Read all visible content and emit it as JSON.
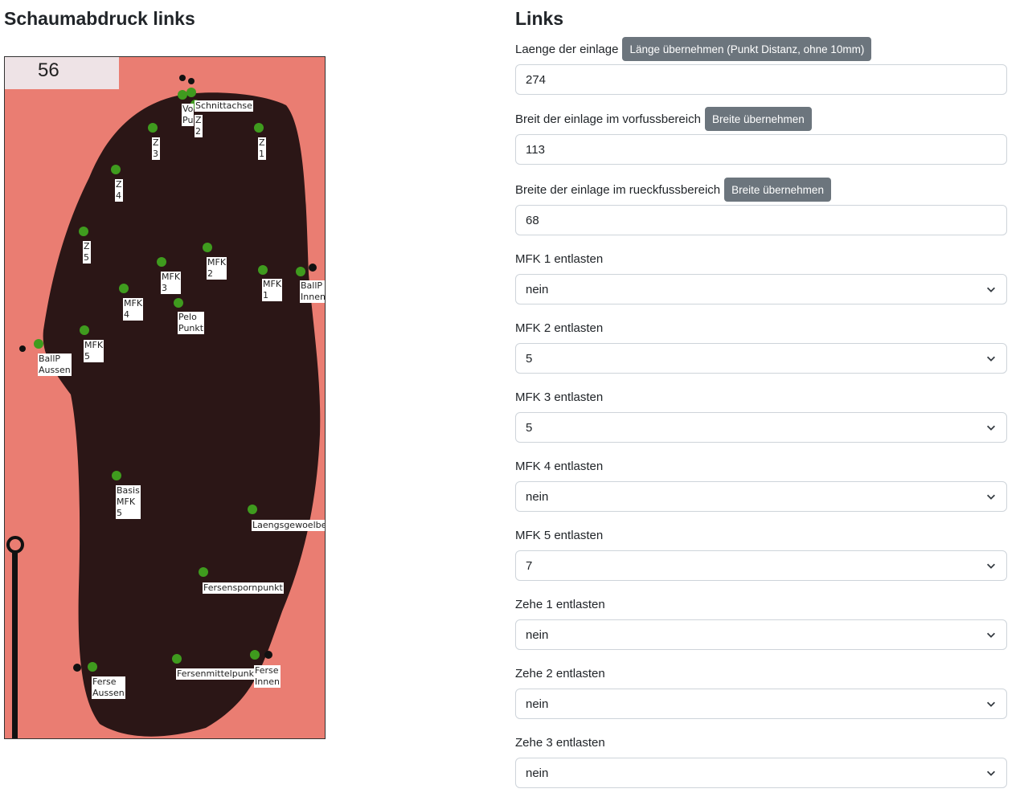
{
  "left": {
    "title": "Schaumabdruck links",
    "scan_number": "56",
    "points": [
      {
        "key": "schnittachse",
        "label": "Schnittachse"
      },
      {
        "key": "vo_punkt",
        "label": "Vo\nPu"
      },
      {
        "key": "z2",
        "label": "Z\n2"
      },
      {
        "key": "z3",
        "label": "Z\n3"
      },
      {
        "key": "z1",
        "label": "Z\n1"
      },
      {
        "key": "z4",
        "label": "Z\n4"
      },
      {
        "key": "z5",
        "label": "Z\n5"
      },
      {
        "key": "mfk2",
        "label": "MFK\n2"
      },
      {
        "key": "mfk3",
        "label": "MFK\n3"
      },
      {
        "key": "mfk1",
        "label": "MFK\n1"
      },
      {
        "key": "ballp_innen",
        "label": "BallP\nInnen"
      },
      {
        "key": "mfk4",
        "label": "MFK\n4"
      },
      {
        "key": "pelo_punkt",
        "label": "Pelo\nPunkt"
      },
      {
        "key": "mfk5",
        "label": "MFK\n5"
      },
      {
        "key": "ballp_aussen",
        "label": "BallP\nAussen"
      },
      {
        "key": "basis_mfk5",
        "label": "Basis\nMFK\n5"
      },
      {
        "key": "laengsgewoelbe",
        "label": "Laengsgewoelbe"
      },
      {
        "key": "fersenspornpunkt",
        "label": "Fersenspornpunkt"
      },
      {
        "key": "fersenmittelpunkt",
        "label": "Fersenmittelpunkt"
      },
      {
        "key": "ferse_innen",
        "label": "Ferse\nInnen"
      },
      {
        "key": "ferse_aussen",
        "label": "Ferse\nAussen"
      }
    ]
  },
  "right": {
    "title": "Links",
    "laenge": {
      "label": "Laenge der einlage",
      "button": "Länge übernehmen (Punkt Distanz, ohne 10mm)",
      "value": "274"
    },
    "breite_vorfuss": {
      "label": "Breit der einlage im vorfussbereich",
      "button": "Breite übernehmen",
      "value": "113"
    },
    "breite_rueckfuss": {
      "label": "Breite der einlage im rueckfussbereich",
      "button": "Breite übernehmen",
      "value": "68"
    },
    "selects": [
      {
        "label": "MFK 1 entlasten",
        "value": "nein"
      },
      {
        "label": "MFK 2 entlasten",
        "value": "5"
      },
      {
        "label": "MFK 3 entlasten",
        "value": "5"
      },
      {
        "label": "MFK 4 entlasten",
        "value": "nein"
      },
      {
        "label": "MFK 5 entlasten",
        "value": "7"
      },
      {
        "label": "Zehe 1 entlasten",
        "value": "nein"
      },
      {
        "label": "Zehe 2 entlasten",
        "value": "nein"
      },
      {
        "label": "Zehe 3 entlasten",
        "value": "nein"
      }
    ]
  },
  "colors": {
    "scan_bg": "#ea7d72",
    "foot": "#2b1616",
    "point": "#3f9b1e",
    "button": "#6c757d"
  }
}
